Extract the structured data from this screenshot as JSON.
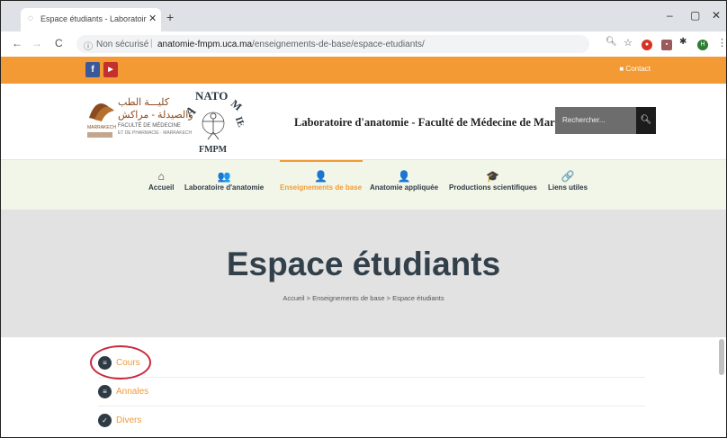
{
  "browser": {
    "tab_title": "Espace étudiants - Laboratoire d",
    "tab_close": "✕",
    "new_tab": "+",
    "minimize": "–",
    "maximize": "▢",
    "close": "✕",
    "back": "←",
    "forward": "→",
    "reload": "C",
    "security_label": "Non sécurisé",
    "url_host": "anatomie-fmpm.uca.ma",
    "url_path": "/enseignements-de-base/espace-etudiants/"
  },
  "topbar": {
    "color": "#f39a34",
    "facebook": "f",
    "youtube": "▶",
    "contact": "Contact"
  },
  "header": {
    "logo_arabic_1": "كليـــة الطب",
    "logo_arabic_2": "والصيدلة - مراكش",
    "logo_french_1": "FACULTÉ DE MÉDECINE",
    "logo_french_2": "ET DE PHARMACIE · MARRAKECH",
    "site_title": "Laboratoire d'anatomie - Faculté de Médecine de Marrakech",
    "search_placeholder": "Rechercher...",
    "search_icon": "search-icon"
  },
  "menu": {
    "items": [
      {
        "label": "Accueil",
        "icon": "home-icon",
        "glyph": "⌂"
      },
      {
        "label": "Laboratoire d'anatomie",
        "icon": "users-icon",
        "glyph": "👥"
      },
      {
        "label": "Enseignements de base",
        "icon": "teacher-icon",
        "glyph": "👤"
      },
      {
        "label": "Anatomie appliquée",
        "icon": "user-icon",
        "glyph": "👤"
      },
      {
        "label": "Productions scientifiques",
        "icon": "graduation-cap-icon",
        "glyph": "🎓"
      },
      {
        "label": "Liens utiles",
        "icon": "link-icon",
        "glyph": "🔗"
      }
    ],
    "active": "Enseignements de base"
  },
  "hero": {
    "title": "Espace étudiants",
    "breadcrumb": "Accueil > Enseignements de base > Espace étudiants"
  },
  "list": [
    {
      "label": "Cours",
      "glyph": "≡"
    },
    {
      "label": "Annales",
      "glyph": "≡"
    },
    {
      "label": "Divers",
      "glyph": "✓"
    }
  ],
  "colors": {
    "accent": "#f39a34",
    "dark": "#2e3a44",
    "highlight": "#c8283c"
  }
}
